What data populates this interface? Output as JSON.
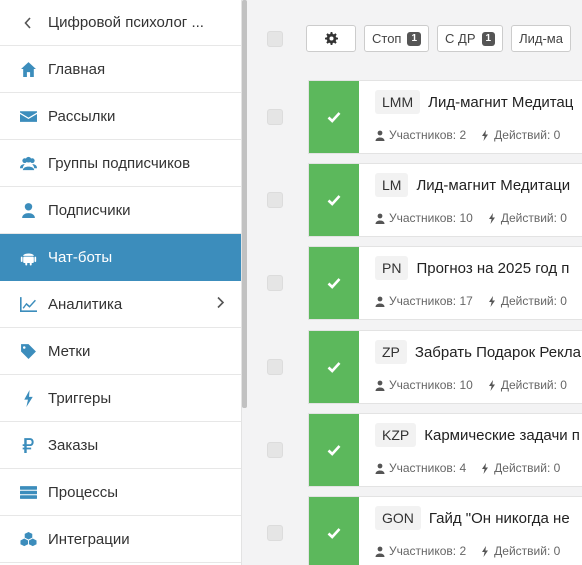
{
  "sidebar": {
    "back_title": "Цифровой психолог ...",
    "items": [
      {
        "label": "Главная",
        "icon": "home-icon"
      },
      {
        "label": "Рассылки",
        "icon": "envelope-icon"
      },
      {
        "label": "Группы подписчиков",
        "icon": "users-icon"
      },
      {
        "label": "Подписчики",
        "icon": "user-icon"
      },
      {
        "label": "Чат-боты",
        "icon": "android-icon",
        "active": true
      },
      {
        "label": "Аналитика",
        "icon": "line-chart-icon",
        "has_submenu": true
      },
      {
        "label": "Метки",
        "icon": "tag-icon"
      },
      {
        "label": "Триггеры",
        "icon": "bolt-icon"
      },
      {
        "label": "Заказы",
        "icon": "ruble-icon"
      },
      {
        "label": "Процессы",
        "icon": "server-icon"
      },
      {
        "label": "Интеграции",
        "icon": "cubes-icon"
      }
    ]
  },
  "toolbar": {
    "stop_label": "Стоп",
    "stop_count": "1",
    "dr_label": "С ДР",
    "dr_count": "1",
    "filter_label": "Лид-ма"
  },
  "bots": [
    {
      "code": "LMM",
      "name": "Лид-магнит Медитац",
      "participants": "Участников: 2",
      "actions": "Действий: 0",
      "status": "active"
    },
    {
      "code": "LM",
      "name": "Лид-магнит Медитаци",
      "participants": "Участников: 10",
      "actions": "Действий: 0",
      "status": "active"
    },
    {
      "code": "PN",
      "name": "Прогноз на 2025 год п",
      "participants": "Участников: 17",
      "actions": "Действий: 0",
      "status": "active"
    },
    {
      "code": "ZP",
      "name": "Забрать Подарок Рекла",
      "participants": "Участников: 10",
      "actions": "Действий: 0",
      "status": "active"
    },
    {
      "code": "KZP",
      "name": "Кармические задачи п",
      "participants": "Участников: 4",
      "actions": "Действий: 0",
      "status": "active"
    },
    {
      "code": "GON",
      "name": "Гайд \"Он никогда не",
      "participants": "Участников: 2",
      "actions": "Действий: 0",
      "status": "active"
    }
  ],
  "colors": {
    "accent": "#3c8dbc",
    "status_active": "#5cb85c"
  }
}
